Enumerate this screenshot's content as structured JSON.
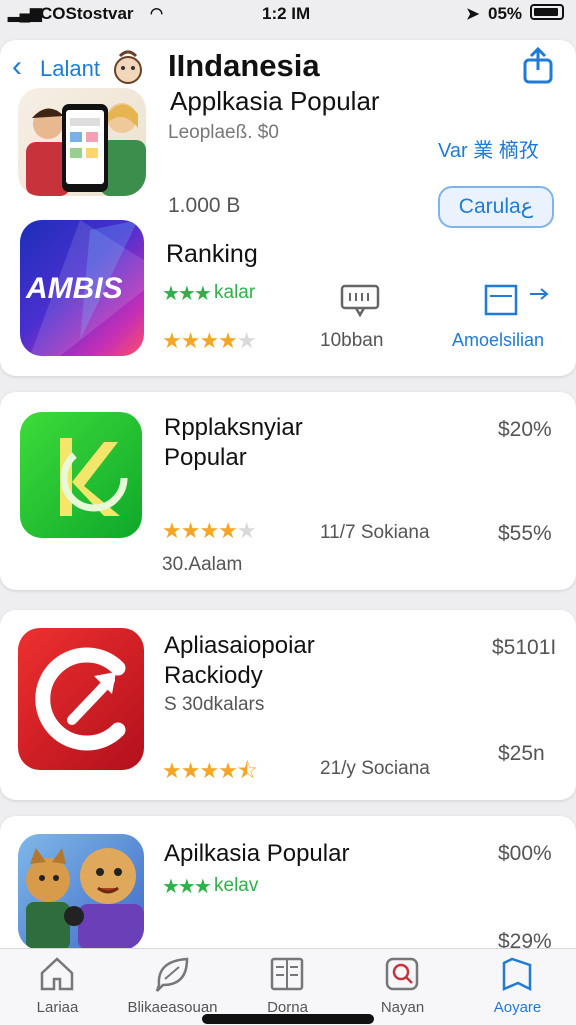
{
  "status_bar": {
    "carrier": "COStostvar",
    "time": "1:2 IM",
    "battery": "05%"
  },
  "header": {
    "back_label": "Lalant",
    "title": "IIndanesia",
    "subtitle": "Applkasia Popular",
    "meta_line": "Leoplaeß. $0",
    "side_text": "Var 業 樀孜",
    "size_text": "1.000 B",
    "get_button": "Carulaع"
  },
  "featured": {
    "icon_text": "AMBIS",
    "title": "Ranking",
    "category": "kalar",
    "rating": 3.5,
    "rating_label": "10bban",
    "action_label": "Amoelsilian"
  },
  "apps": [
    {
      "title_line1": "Rpplaksnyiar",
      "title_line2": "Popular",
      "price": "$20%",
      "rating": 3.5,
      "reviews": "11/7 Sokiana",
      "price2": "$55%",
      "footer": "30.Aalam"
    },
    {
      "title_line1": "Apliasaiopoiar",
      "title_line2": "Rackiody",
      "subtitle": "S 30dkalars",
      "price": "$5101I",
      "rating": 4.5,
      "reviews": "21/y Sociana",
      "price2": "$25n"
    },
    {
      "title_line1": "Apilkasia Popular",
      "category": "kelav",
      "price": "$00%",
      "price2": "$29%"
    }
  ],
  "tabbar": {
    "tabs": [
      {
        "label": "Lariaa",
        "icon": "home-icon"
      },
      {
        "label": "Blikaeasouan",
        "icon": "chat-leaf-icon"
      },
      {
        "label": "Dorna",
        "icon": "document-icon"
      },
      {
        "label": "Nayan",
        "icon": "search-app-icon"
      },
      {
        "label": "Aoyare",
        "icon": "bookmark-icon",
        "active": true
      }
    ]
  },
  "colors": {
    "accent": "#1f7bd6",
    "star": "#f5a623",
    "green_star": "#2fb04a"
  }
}
